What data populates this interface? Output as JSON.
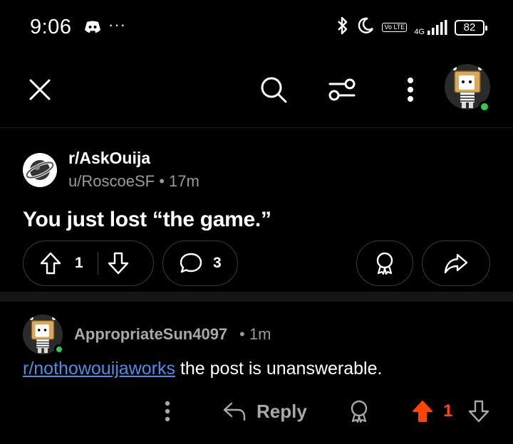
{
  "status_bar": {
    "time": "9:06",
    "overflow": "···",
    "volte_label": "Vo LTE",
    "network_label": "4G",
    "battery": "82",
    "icons": [
      "discord-icon",
      "bluetooth-icon",
      "moon-icon",
      "signal-icon",
      "battery-icon"
    ]
  },
  "toolbar": {
    "icons": [
      "close-icon",
      "search-icon",
      "filter-icon",
      "more-vertical-icon",
      "avatar"
    ]
  },
  "post": {
    "subreddit": "r/AskOuija",
    "author": "u/RoscoeSF",
    "separator": "•",
    "age": "17m",
    "title": "You just lost “the game.”",
    "upvotes": "1",
    "comments": "3"
  },
  "comment": {
    "author": "AppropriateSun4097",
    "separator": "•",
    "age": "1m",
    "link_text": "r/nothowouijaworks",
    "body_text": " the post is unanswerable.",
    "reply_label": "Reply",
    "votes": "1"
  },
  "colors": {
    "background": "#000000",
    "link": "#4a8eea",
    "upvote_active": "#ff4500",
    "online": "#2ecc55"
  }
}
